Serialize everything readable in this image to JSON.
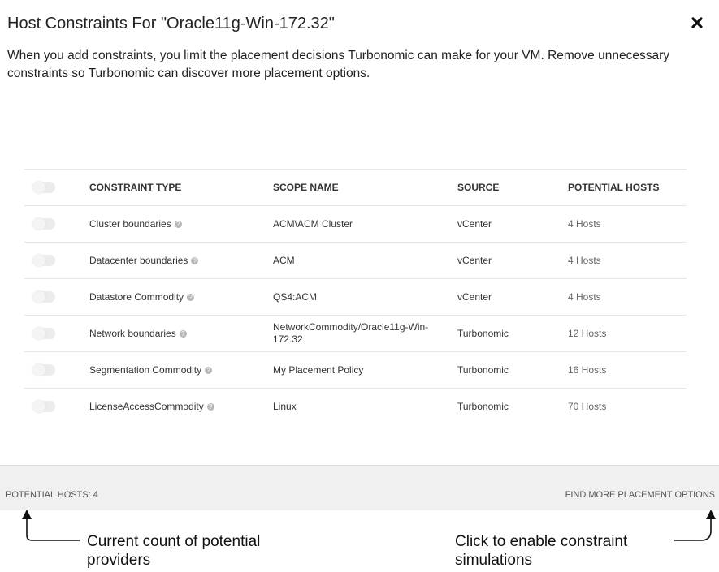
{
  "dialog": {
    "title": "Host Constraints For \"Oracle11g-Win-172.32\"",
    "description": "When you add constraints, you limit the placement decisions Turbonomic can make for your VM. Remove unnecessary constraints so Turbonomic can discover more placement options."
  },
  "table": {
    "headers": {
      "type": "CONSTRAINT TYPE",
      "scope": "SCOPE NAME",
      "source": "SOURCE",
      "hosts": "POTENTIAL HOSTS"
    },
    "rows": [
      {
        "type": "Cluster boundaries",
        "scope": "ACM\\ACM Cluster",
        "source": "vCenter",
        "hosts": "4 Hosts",
        "enabled": false
      },
      {
        "type": "Datacenter boundaries",
        "scope": "ACM",
        "source": "vCenter",
        "hosts": "4 Hosts",
        "enabled": false
      },
      {
        "type": "Datastore Commodity",
        "scope": "QS4:ACM",
        "source": "vCenter",
        "hosts": "4 Hosts",
        "enabled": false
      },
      {
        "type": "Network boundaries",
        "scope": "NetworkCommodity/Oracle11g-Win-172.32",
        "source": "Turbonomic",
        "hosts": "12 Hosts",
        "enabled": false
      },
      {
        "type": "Segmentation Commodity",
        "scope": "My Placement Policy",
        "source": "Turbonomic",
        "hosts": "16 Hosts",
        "enabled": false
      },
      {
        "type": "LicenseAccessCommodity",
        "scope": "Linux",
        "source": "Turbonomic",
        "hosts": "70 Hosts",
        "enabled": false
      }
    ]
  },
  "footer": {
    "potential_hosts": "POTENTIAL HOSTS: 4",
    "find_more": "FIND MORE PLACEMENT OPTIONS"
  },
  "annotations": {
    "left": "Current count of potential providers",
    "right": "Click to enable constraint simulations"
  },
  "icons": {
    "close": "close-icon",
    "help": "help-icon"
  }
}
